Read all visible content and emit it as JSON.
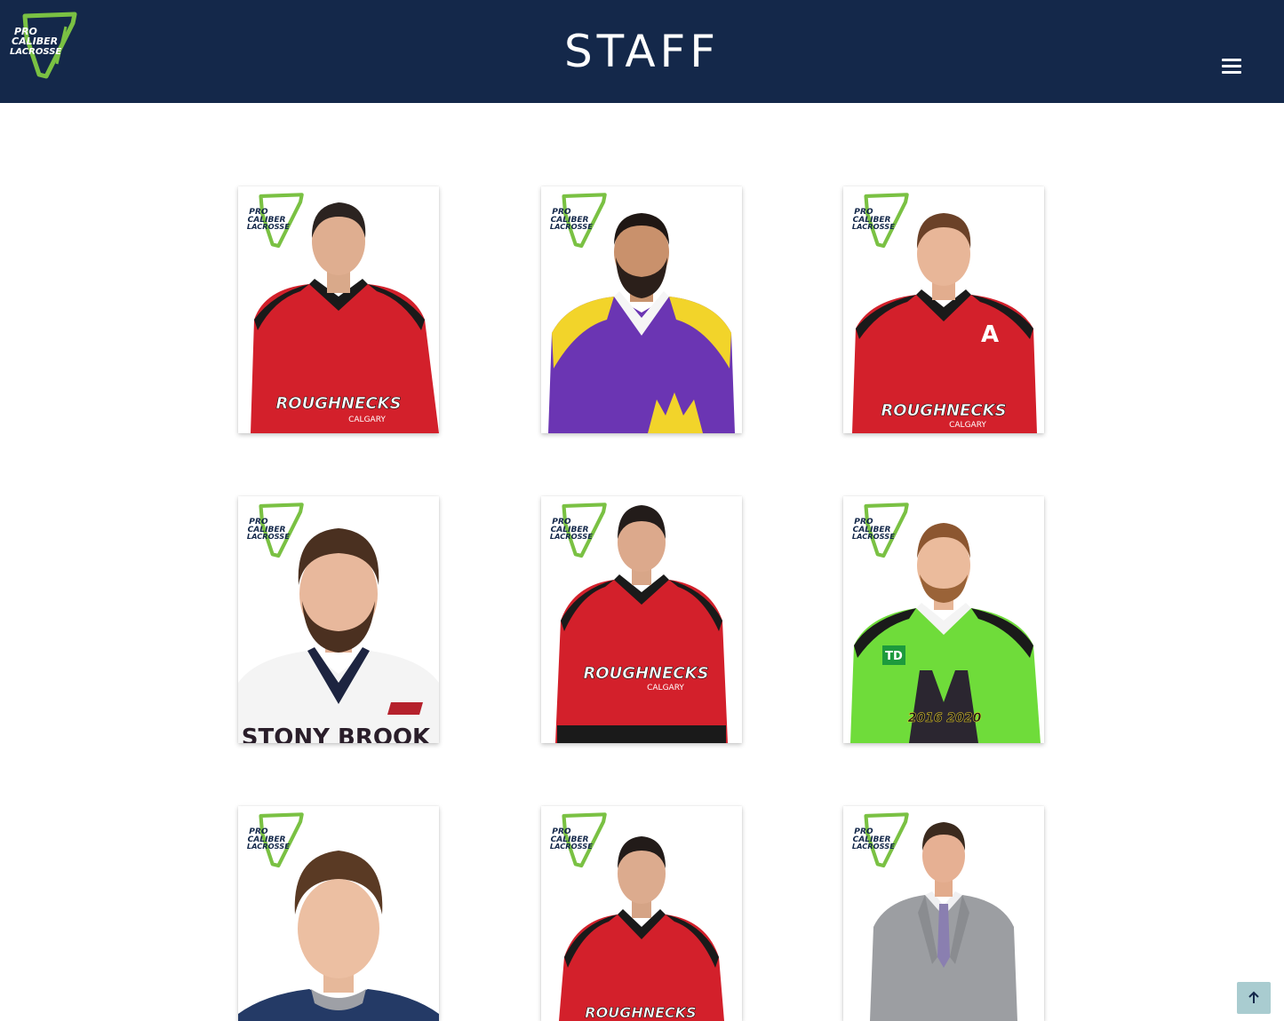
{
  "header": {
    "title": "STAFF",
    "logo_icon": "pro-caliber-lacrosse-logo",
    "logo_text": [
      "PRO",
      "CALIBER",
      "LACROSSE"
    ],
    "menu_icon": "hamburger-menu-icon",
    "background_color": "#14284a",
    "logo_accent_color": "#7ac143"
  },
  "staff": [
    {
      "jersey": "red-black",
      "jersey_text": "ROUGHNECKS",
      "jersey_subtext": "CALGARY",
      "hair": "#2b2320"
    },
    {
      "jersey": "purple-yellow",
      "jersey_text": "",
      "jersey_subtext": "",
      "hair": "#1f1714"
    },
    {
      "jersey": "red-black",
      "jersey_text": "ROUGHNECKS",
      "jersey_subtext": "CALGARY",
      "jersey_letter": "A",
      "hair": "#6b4128"
    },
    {
      "jersey": "white-navy",
      "jersey_text": "STONY BROOK",
      "jersey_subtext": "",
      "hair": "#4a3020"
    },
    {
      "jersey": "red-black",
      "jersey_text": "ROUGHNECKS",
      "jersey_subtext": "CALGARY",
      "hair": "#231c1a"
    },
    {
      "jersey": "green-black",
      "jersey_text": "2016 2020",
      "jersey_subtext": "TD",
      "hair": "#8c5630"
    },
    {
      "jersey": "navy",
      "jersey_text": "",
      "jersey_subtext": "",
      "hair": "#5a3a24"
    },
    {
      "jersey": "red-black",
      "jersey_text": "ROUGHNECKS",
      "jersey_subtext": "",
      "hair": "#221b19"
    },
    {
      "jersey": "grey-suit",
      "jersey_text": "",
      "jersey_subtext": "",
      "hair": "#3b2a1e"
    }
  ],
  "scroll_top": {
    "icon": "arrow-up-icon",
    "color": "#a9ccd0"
  }
}
